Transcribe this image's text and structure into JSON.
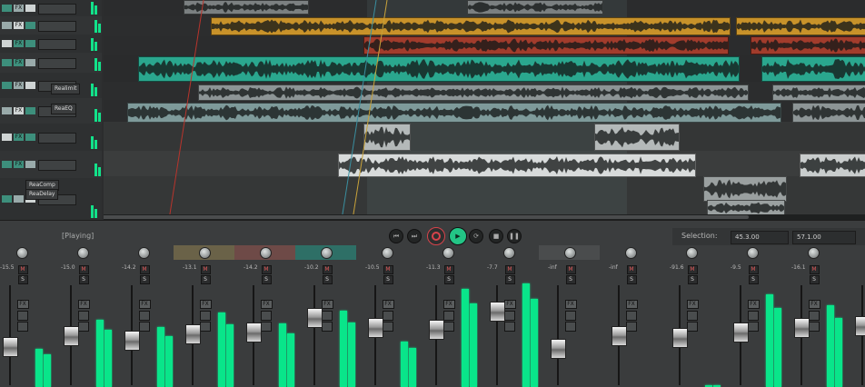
{
  "colors": {
    "background": "#262829",
    "meter_green": "#09e58a",
    "clip_teal": "#2aa78e",
    "clip_orange": "#c8922a",
    "clip_red": "#a23c2c",
    "clip_gray": "#8d9596",
    "clip_light": "#c9cdcd",
    "selection": "#6a8a8c",
    "play_cursor": "#c8a23a",
    "edit_cursor": "#b8342c",
    "record_button": "#d8434b",
    "play_button": "#23c586"
  },
  "transport": {
    "status": "[Playing]",
    "selection_label": "Selection:",
    "selection_start": "45.3.00",
    "selection_end": "57.1.00",
    "buttons": [
      {
        "name": "go-to-start",
        "icon": "skip-back-icon"
      },
      {
        "name": "go-to-end",
        "icon": "skip-forward-icon"
      },
      {
        "name": "record",
        "icon": "record-icon"
      },
      {
        "name": "play",
        "icon": "play-icon"
      },
      {
        "name": "repeat",
        "icon": "repeat-icon"
      },
      {
        "name": "stop",
        "icon": "stop-icon"
      },
      {
        "name": "pause",
        "icon": "pause-icon"
      }
    ]
  },
  "track_panel": {
    "plugin_labels": [
      "Realimit",
      "ReaEQ",
      "ReaComp",
      "ReaDelay"
    ],
    "button_labels": [
      "FX",
      "FX",
      "FX",
      "FX",
      "FX",
      "FX",
      "FX",
      "FX"
    ]
  },
  "mixer": {
    "channels": [
      {
        "peak": "-15.5",
        "fader": 0.37,
        "meter": 0.35
      },
      {
        "peak": "-15.0",
        "fader": 0.5,
        "meter": 0.62
      },
      {
        "peak": "-14.2",
        "fader": 0.45,
        "meter": 0.55
      },
      {
        "peak": "-13.1",
        "fader": 0.52,
        "meter": 0.68
      },
      {
        "peak": "-14.2",
        "fader": 0.55,
        "meter": 0.58
      },
      {
        "peak": "-10.2",
        "fader": 0.72,
        "meter": 0.7
      },
      {
        "peak": "-10.5",
        "fader": 0.6,
        "meter": 0.42
      },
      {
        "peak": "-11.3",
        "fader": 0.58,
        "meter": 0.9
      },
      {
        "peak": "-7.7",
        "fader": 0.8,
        "meter": 0.95
      },
      {
        "peak": "-inf",
        "fader": 0.35,
        "meter": 0.0
      },
      {
        "peak": "-inf",
        "fader": 0.5,
        "meter": 0.0
      },
      {
        "peak": "-91.6",
        "fader": 0.48,
        "meter": 0.02
      },
      {
        "peak": "-9.5",
        "fader": 0.55,
        "meter": 0.85
      },
      {
        "peak": "-16.1",
        "fader": 0.6,
        "meter": 0.75
      },
      {
        "peak": "",
        "fader": 0.62,
        "meter": 0.8
      }
    ],
    "button_mute": "M",
    "button_solo": "S",
    "button_fx": "FX"
  }
}
